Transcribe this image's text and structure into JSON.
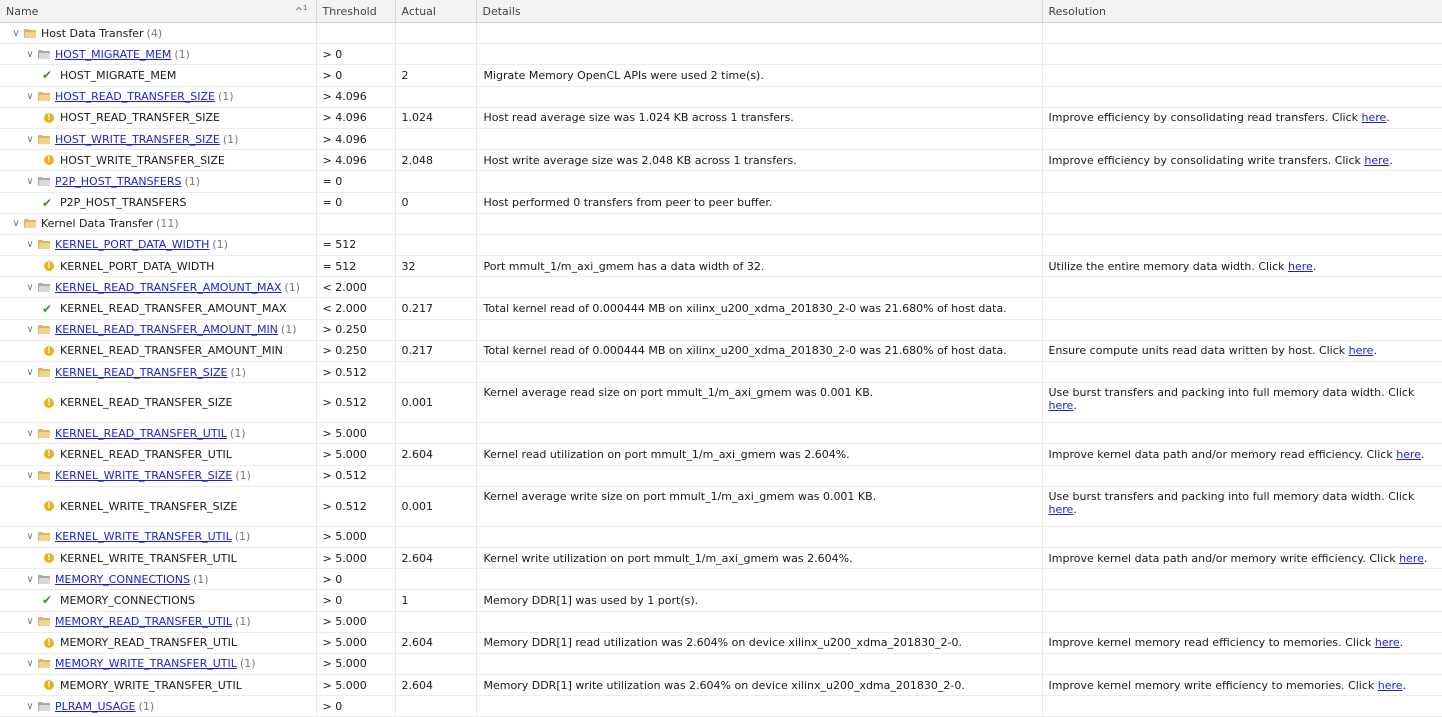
{
  "columns": {
    "name": "Name",
    "threshold": "Threshold",
    "actual": "Actual",
    "details": "Details",
    "resolution": "Resolution",
    "sort_indicator": "^",
    "sort_index": "1"
  },
  "rows": [
    {
      "level": 0,
      "kind": "group",
      "folder": "gold",
      "name": "Host Data Transfer",
      "count": "(4)",
      "threshold": "",
      "actual": "",
      "details": "",
      "res_text": "",
      "res_link": ""
    },
    {
      "level": 1,
      "kind": "group",
      "folder": "gray",
      "name": "HOST_MIGRATE_MEM",
      "count": "(1)",
      "threshold": "> 0",
      "actual": "",
      "details": "",
      "res_text": "",
      "res_link": ""
    },
    {
      "level": 2,
      "kind": "ok",
      "name": "HOST_MIGRATE_MEM",
      "threshold": "> 0",
      "actual": "2",
      "details": "Migrate Memory OpenCL APIs were used 2 time(s).",
      "res_text": "",
      "res_link": ""
    },
    {
      "level": 1,
      "kind": "group",
      "folder": "gold",
      "name": "HOST_READ_TRANSFER_SIZE",
      "count": "(1)",
      "threshold": "> 4.096",
      "actual": "",
      "details": "",
      "res_text": "",
      "res_link": ""
    },
    {
      "level": 2,
      "kind": "warn",
      "name": "HOST_READ_TRANSFER_SIZE",
      "threshold": "> 4.096",
      "actual": "1.024",
      "details": "Host read average size was 1.024 KB across 1 transfers.",
      "res_text": "Improve efficiency by consolidating read transfers. Click ",
      "res_link": "here",
      "res_tail": "."
    },
    {
      "level": 1,
      "kind": "group",
      "folder": "gold",
      "name": "HOST_WRITE_TRANSFER_SIZE",
      "count": "(1)",
      "threshold": "> 4.096",
      "actual": "",
      "details": "",
      "res_text": "",
      "res_link": ""
    },
    {
      "level": 2,
      "kind": "warn",
      "name": "HOST_WRITE_TRANSFER_SIZE",
      "threshold": "> 4.096",
      "actual": "2.048",
      "details": "Host write average size was 2.048 KB across 1 transfers.",
      "res_text": "Improve efficiency by consolidating write transfers. Click ",
      "res_link": "here",
      "res_tail": "."
    },
    {
      "level": 1,
      "kind": "group",
      "folder": "gray",
      "name": "P2P_HOST_TRANSFERS",
      "count": "(1)",
      "threshold": "= 0",
      "actual": "",
      "details": "",
      "res_text": "",
      "res_link": ""
    },
    {
      "level": 2,
      "kind": "ok",
      "name": "P2P_HOST_TRANSFERS",
      "threshold": "= 0",
      "actual": "0",
      "details": "Host performed 0 transfers from peer to peer buffer.",
      "res_text": "",
      "res_link": ""
    },
    {
      "level": 0,
      "kind": "group",
      "folder": "gold",
      "name": "Kernel Data Transfer",
      "count": "(11)",
      "threshold": "",
      "actual": "",
      "details": "",
      "res_text": "",
      "res_link": ""
    },
    {
      "level": 1,
      "kind": "group",
      "folder": "gold",
      "name": "KERNEL_PORT_DATA_WIDTH",
      "count": "(1)",
      "threshold": "= 512",
      "actual": "",
      "details": "",
      "res_text": "",
      "res_link": ""
    },
    {
      "level": 2,
      "kind": "warn",
      "name": "KERNEL_PORT_DATA_WIDTH",
      "threshold": "= 512",
      "actual": "32",
      "details": "Port mmult_1/m_axi_gmem has a data width of 32.",
      "res_text": "Utilize the entire memory data width. Click ",
      "res_link": "here",
      "res_tail": "."
    },
    {
      "level": 1,
      "kind": "group",
      "folder": "gray",
      "name": "KERNEL_READ_TRANSFER_AMOUNT_MAX",
      "count": "(1)",
      "threshold": "< 2.000",
      "actual": "",
      "details": "",
      "res_text": "",
      "res_link": ""
    },
    {
      "level": 2,
      "kind": "ok",
      "name": "KERNEL_READ_TRANSFER_AMOUNT_MAX",
      "threshold": "< 2.000",
      "actual": "0.217",
      "details": "Total kernel read of 0.000444 MB on xilinx_u200_xdma_201830_2-0 was 21.680% of host data.",
      "res_text": "",
      "res_link": ""
    },
    {
      "level": 1,
      "kind": "group",
      "folder": "gold",
      "name": "KERNEL_READ_TRANSFER_AMOUNT_MIN",
      "count": "(1)",
      "threshold": "> 0.250",
      "actual": "",
      "details": "",
      "res_text": "",
      "res_link": ""
    },
    {
      "level": 2,
      "kind": "warn",
      "name": "KERNEL_READ_TRANSFER_AMOUNT_MIN",
      "threshold": "> 0.250",
      "actual": "0.217",
      "details": "Total kernel read of 0.000444 MB on xilinx_u200_xdma_201830_2-0 was 21.680% of host data.",
      "res_text": "Ensure compute units read data written by host. Click ",
      "res_link": "here",
      "res_tail": "."
    },
    {
      "level": 1,
      "kind": "group",
      "folder": "gold",
      "name": "KERNEL_READ_TRANSFER_SIZE",
      "count": "(1)",
      "threshold": "> 0.512",
      "actual": "",
      "details": "",
      "res_text": "",
      "res_link": ""
    },
    {
      "level": 2,
      "kind": "warn",
      "tall": true,
      "name": "KERNEL_READ_TRANSFER_SIZE",
      "threshold": "> 0.512",
      "actual": "0.001",
      "details": "Kernel average read size on port mmult_1/m_axi_gmem was 0.001 KB.",
      "res_text": "Use burst transfers and packing into full memory data width. Click ",
      "res_link": "here",
      "res_tail": "."
    },
    {
      "level": 1,
      "kind": "group",
      "folder": "gold",
      "name": "KERNEL_READ_TRANSFER_UTIL",
      "count": "(1)",
      "threshold": "> 5.000",
      "actual": "",
      "details": "",
      "res_text": "",
      "res_link": ""
    },
    {
      "level": 2,
      "kind": "warn",
      "name": "KERNEL_READ_TRANSFER_UTIL",
      "threshold": "> 5.000",
      "actual": "2.604",
      "details": "Kernel read utilization on port mmult_1/m_axi_gmem was 2.604%.",
      "res_text": "Improve kernel data path and/or memory read efficiency. Click ",
      "res_link": "here",
      "res_tail": "."
    },
    {
      "level": 1,
      "kind": "group",
      "folder": "gold",
      "name": "KERNEL_WRITE_TRANSFER_SIZE",
      "count": "(1)",
      "threshold": "> 0.512",
      "actual": "",
      "details": "",
      "res_text": "",
      "res_link": ""
    },
    {
      "level": 2,
      "kind": "warn",
      "tall": true,
      "name": "KERNEL_WRITE_TRANSFER_SIZE",
      "threshold": "> 0.512",
      "actual": "0.001",
      "details": "Kernel average write size on port mmult_1/m_axi_gmem was 0.001 KB.",
      "res_text": "Use burst transfers and packing into full memory data width. Click ",
      "res_link": "here",
      "res_tail": "."
    },
    {
      "level": 1,
      "kind": "group",
      "folder": "gold",
      "name": "KERNEL_WRITE_TRANSFER_UTIL",
      "count": "(1)",
      "threshold": "> 5.000",
      "actual": "",
      "details": "",
      "res_text": "",
      "res_link": ""
    },
    {
      "level": 2,
      "kind": "warn",
      "name": "KERNEL_WRITE_TRANSFER_UTIL",
      "threshold": "> 5.000",
      "actual": "2.604",
      "details": "Kernel write utilization on port mmult_1/m_axi_gmem was 2.604%.",
      "res_text": "Improve kernel data path and/or memory write efficiency. Click ",
      "res_link": "here",
      "res_tail": "."
    },
    {
      "level": 1,
      "kind": "group",
      "folder": "gray",
      "name": "MEMORY_CONNECTIONS",
      "count": "(1)",
      "threshold": "> 0",
      "actual": "",
      "details": "",
      "res_text": "",
      "res_link": ""
    },
    {
      "level": 2,
      "kind": "ok",
      "name": "MEMORY_CONNECTIONS",
      "threshold": "> 0",
      "actual": "1",
      "details": "Memory DDR[1] was used by 1 port(s).",
      "res_text": "",
      "res_link": ""
    },
    {
      "level": 1,
      "kind": "group",
      "folder": "gold",
      "name": "MEMORY_READ_TRANSFER_UTIL",
      "count": "(1)",
      "threshold": "> 5.000",
      "actual": "",
      "details": "",
      "res_text": "",
      "res_link": ""
    },
    {
      "level": 2,
      "kind": "warn",
      "name": "MEMORY_READ_TRANSFER_UTIL",
      "threshold": "> 5.000",
      "actual": "2.604",
      "details": "Memory DDR[1] read utilization was 2.604% on device xilinx_u200_xdma_201830_2-0.",
      "res_text": "Improve kernel memory read efficiency to memories. Click ",
      "res_link": "here",
      "res_tail": "."
    },
    {
      "level": 1,
      "kind": "group",
      "folder": "gold",
      "name": "MEMORY_WRITE_TRANSFER_UTIL",
      "count": "(1)",
      "threshold": "> 5.000",
      "actual": "",
      "details": "",
      "res_text": "",
      "res_link": ""
    },
    {
      "level": 2,
      "kind": "warn",
      "name": "MEMORY_WRITE_TRANSFER_UTIL",
      "threshold": "> 5.000",
      "actual": "2.604",
      "details": "Memory DDR[1] write utilization was 2.604% on device xilinx_u200_xdma_201830_2-0.",
      "res_text": "Improve kernel memory write efficiency to memories. Click ",
      "res_link": "here",
      "res_tail": "."
    },
    {
      "level": 1,
      "kind": "group",
      "folder": "gray",
      "name": "PLRAM_USAGE",
      "count": "(1)",
      "threshold": "> 0",
      "actual": "",
      "details": "",
      "res_text": "",
      "res_link": ""
    }
  ],
  "icons": {
    "expand": "chevron-down-icon",
    "ok": "check-icon",
    "warn": "warning-icon",
    "folder": "folder-icon"
  },
  "colors": {
    "link": "#1a1fd8",
    "ok": "#2e9b2e",
    "warn": "#e8b21b",
    "folder_gold": "#d8b46a",
    "folder_gray": "#a9a9a9",
    "header_bg": "#f3f3f3"
  }
}
